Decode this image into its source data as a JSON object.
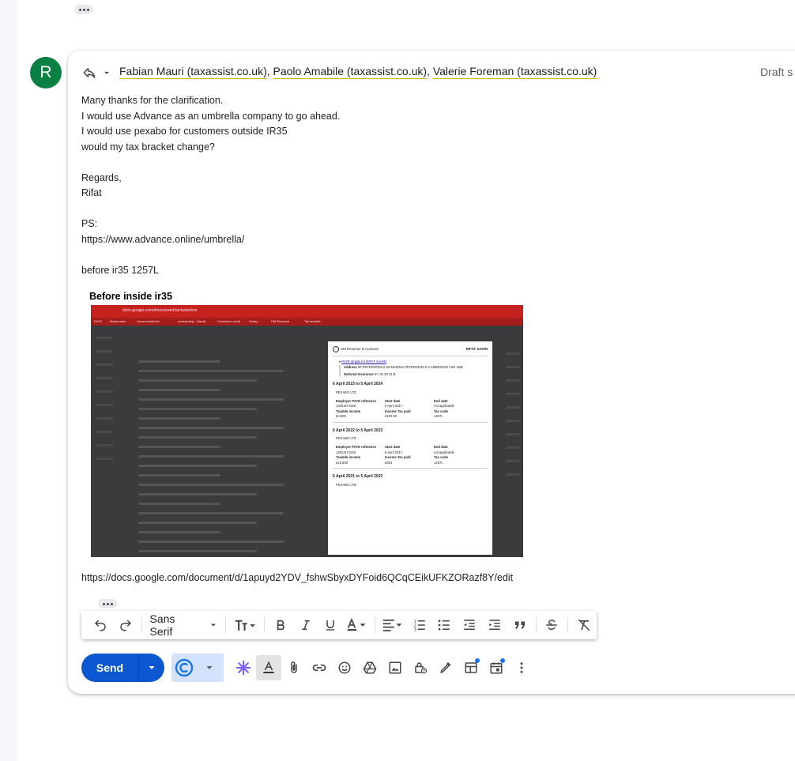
{
  "recipients": [
    "Fabian Mauri (taxassist.co.uk)",
    "Paolo Amabile (taxassist.co.uk)",
    "Valerie Foreman (taxassist.co.uk)"
  ],
  "recipient_separator": ",",
  "draft_label": "Draft s",
  "avatar_letter": "R",
  "body_lines": [
    "Many thanks for the clarification.",
    "I would use Advance as an umbrella company to go ahead.",
    "I would use pexabo for customers outside IR35",
    "would my tax bracket change?",
    "",
    "Regards,",
    "Rifat",
    "",
    "PS:",
    "https://www.advance.online/umbrella/",
    "",
    "before ir35 1257L"
  ],
  "inline_image": {
    "caption": "Before inside ir35",
    "browser_url": "drive.google.com/drive/search/q=taxbefore",
    "bookmarks": [
      "PAYE",
      "Bookmarks",
      "Documents/infor",
      "onboarding - infra@",
      "Codebook nuvid",
      "Salary",
      "HM Revenue",
      "Tax bracket"
    ],
    "doc": {
      "agency": "HM Revenue & Customs",
      "name_header": "RIFAT SAHIN",
      "paye_link": "PAYE details for RIFAT SAHIN",
      "address_label": "Address",
      "address": "90 PETERSFIELD MANSIONS PETERSFIELD CAMBRIDGE CB1 1BB",
      "ni_label": "National Insurance",
      "ni": "SY 31 30 21 B",
      "periods": [
        {
          "title": "6 April 2023 to 5 April 2024",
          "employer": "PEXABO LTD",
          "paye_ref": "120/LB74158",
          "start": "6 April 2017",
          "end": "not applicable",
          "taxable": "£2,600",
          "tax_paid": "£100.00",
          "code": "1257L"
        },
        {
          "title": "6 April 2022 to 5 April 2023",
          "employer": "PEXABO LTD",
          "paye_ref": "120/LB74158",
          "start": "6 April 2017",
          "end": "not applicable",
          "taxable": "£15,600",
          "tax_paid": "£604",
          "code": "1257L"
        },
        {
          "title": "6 April 2021 to 5 April 2022",
          "employer": "PEXABO LTD"
        }
      ],
      "col_labels": {
        "paye_ref": "Employer PAYE reference",
        "start": "Start date",
        "end": "End date",
        "taxable": "Taxable income",
        "tax_paid": "Income Tax paid",
        "code": "Tax code"
      }
    }
  },
  "doc_link": "https://docs.google.com/document/d/1apuyd2YDV_fshwSbyxDYFoid6QCqCEikUFKZORazf8Y/edit",
  "toolbar": {
    "font": "Sans Serif"
  },
  "send": {
    "label": "Send"
  },
  "colors": {
    "send_blue": "#0b57d0",
    "avatar_green": "#0b8043",
    "recipient_underline": "#e0b700"
  }
}
